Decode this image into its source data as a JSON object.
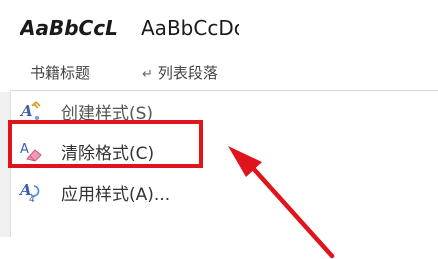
{
  "gallery": {
    "previews": [
      {
        "text": "AaBbCcL"
      },
      {
        "text": "AaBbCcDc"
      }
    ],
    "names": [
      {
        "text": "书籍标题"
      },
      {
        "text": "列表段落",
        "mark": "↵"
      }
    ]
  },
  "menu": {
    "items": [
      {
        "label": "创建样式(S)",
        "icon": "create-style-icon"
      },
      {
        "label": "清除格式(C)",
        "icon": "clear-formatting-icon"
      },
      {
        "label": "应用样式(A)...",
        "icon": "apply-style-icon"
      }
    ]
  },
  "annotation": {
    "highlight_color": "#e0141c",
    "arrow_color": "#e0141c"
  }
}
